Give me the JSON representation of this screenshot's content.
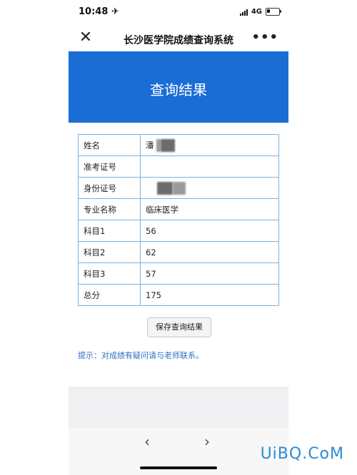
{
  "status": {
    "time": "10:48 ✈",
    "network": "4G"
  },
  "nav": {
    "close": "✕",
    "title": "长沙医学院成绩查询系统",
    "more": "•••"
  },
  "banner": {
    "title": "查询结果"
  },
  "rows": [
    {
      "label": "姓名",
      "value": "潘"
    },
    {
      "label": "准考证号",
      "value": ""
    },
    {
      "label": "身份证号",
      "value": ""
    },
    {
      "label": "专业名称",
      "value": "临床医学"
    },
    {
      "label": "科目1",
      "value": "56"
    },
    {
      "label": "科目2",
      "value": "62"
    },
    {
      "label": "科目3",
      "value": "57"
    },
    {
      "label": "总分",
      "value": "175"
    }
  ],
  "save_button": "保存查询结果",
  "hint": "提示：对成绩有疑问请与老师联系。",
  "toolbar": {
    "back": "‹",
    "forward": "›"
  },
  "watermark": "UiBQ.CoM"
}
